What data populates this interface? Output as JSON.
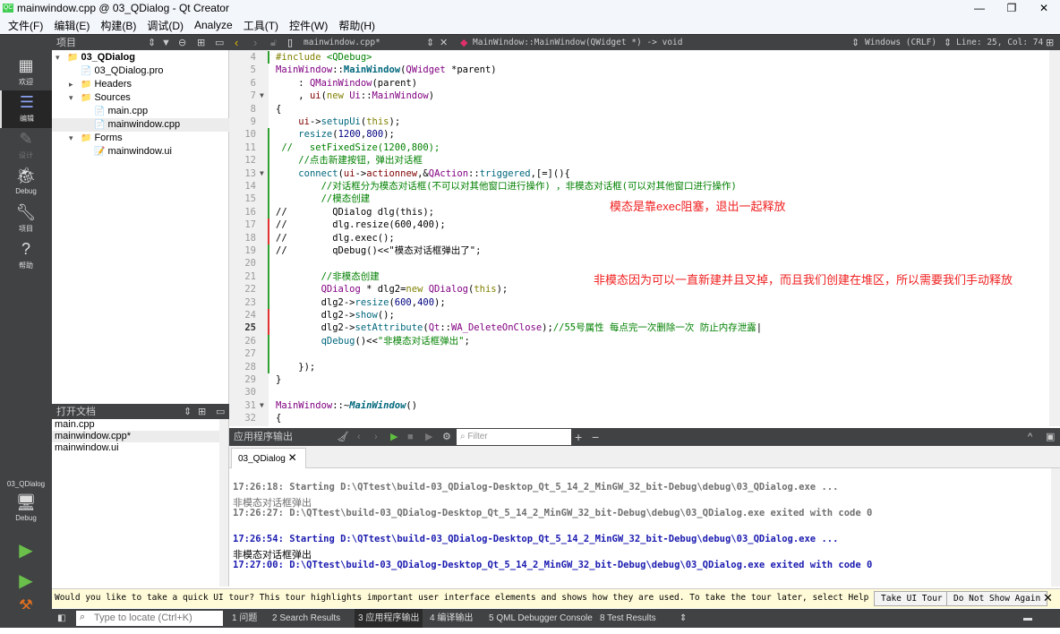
{
  "window": {
    "title": "mainwindow.cpp @ 03_QDialog - Qt Creator",
    "logo": "QC"
  },
  "menu": [
    "文件(F)",
    "编辑(E)",
    "构建(B)",
    "调试(D)",
    "Analyze",
    "工具(T)",
    "控件(W)",
    "帮助(H)"
  ],
  "toolbar": {
    "panel_title": "项目",
    "file": "mainwindow.cpp*",
    "symbol": "MainWindow::MainWindow(QWidget *) -> void",
    "encoding": "Windows (CRLF)",
    "position": "Line: 25, Col: 74"
  },
  "modes": [
    {
      "label": "欢迎",
      "icon": "grid-icon"
    },
    {
      "label": "编辑",
      "icon": "edit-icon"
    },
    {
      "label": "设计",
      "icon": "pencil-icon"
    },
    {
      "label": "Debug",
      "icon": "bug-icon"
    },
    {
      "label": "项目",
      "icon": "wrench-icon"
    },
    {
      "label": "帮助",
      "icon": "help-icon"
    }
  ],
  "kit": {
    "project": "03_QDialog",
    "config": "Debug"
  },
  "tree": [
    {
      "label": "03_QDialog",
      "level": 0,
      "arrow": "▾",
      "icon": "📁",
      "bold": true
    },
    {
      "label": "03_QDialog.pro",
      "level": 1,
      "arrow": "",
      "icon": "📄"
    },
    {
      "label": "Headers",
      "level": 1,
      "arrow": "▸",
      "icon": "📁"
    },
    {
      "label": "Sources",
      "level": 1,
      "arrow": "▾",
      "icon": "📁"
    },
    {
      "label": "main.cpp",
      "level": 2,
      "arrow": "",
      "icon": "📄"
    },
    {
      "label": "mainwindow.cpp",
      "level": 2,
      "arrow": "",
      "icon": "📄",
      "selected": true
    },
    {
      "label": "Forms",
      "level": 1,
      "arrow": "▾",
      "icon": "📁"
    },
    {
      "label": "mainwindow.ui",
      "level": 2,
      "arrow": "",
      "icon": "📝"
    }
  ],
  "open_docs": {
    "title": "打开文档",
    "items": [
      "main.cpp",
      "mainwindow.cpp*",
      "mainwindow.ui"
    ],
    "selected": 1
  },
  "code": [
    {
      "n": 4,
      "mk": "g",
      "s": [
        [
          "#include ",
          "k"
        ],
        [
          "<QDebug>",
          "s"
        ]
      ]
    },
    {
      "n": 5,
      "s": [
        [
          "MainWindow",
          "t"
        ],
        [
          "::",
          ""
        ],
        [
          "MainWindow",
          "fb"
        ],
        [
          "(",
          ""
        ],
        [
          "QWidget",
          "t"
        ],
        [
          " *parent)",
          ""
        ]
      ]
    },
    {
      "n": 6,
      "s": [
        [
          "    : ",
          ""
        ],
        [
          "QMainWindow",
          "t"
        ],
        [
          "(parent)",
          ""
        ]
      ]
    },
    {
      "n": 7,
      "fold": true,
      "s": [
        [
          "    , ",
          ""
        ],
        [
          "ui",
          "m"
        ],
        [
          "(",
          ""
        ],
        [
          "new ",
          "k"
        ],
        [
          "Ui",
          "t"
        ],
        [
          "::",
          ""
        ],
        [
          "MainWindow",
          "t"
        ],
        [
          ")",
          ""
        ]
      ]
    },
    {
      "n": 8,
      "s": [
        [
          "{",
          ""
        ]
      ]
    },
    {
      "n": 9,
      "s": [
        [
          "    ",
          ""
        ],
        [
          "ui",
          "m"
        ],
        [
          "->",
          ""
        ],
        [
          "setupUi",
          "f"
        ],
        [
          "(",
          ""
        ],
        [
          "this",
          "k"
        ],
        [
          ");",
          ""
        ]
      ]
    },
    {
      "n": 10,
      "mk": "g",
      "s": [
        [
          "    ",
          ""
        ],
        [
          "resize",
          "f"
        ],
        [
          "(",
          ""
        ],
        [
          "1200",
          "n"
        ],
        [
          ",",
          ""
        ],
        [
          "800",
          "n"
        ],
        [
          ");",
          ""
        ]
      ]
    },
    {
      "n": 11,
      "mk": "g",
      "s": [
        [
          " //   setFixedSize(1200,800);",
          "c"
        ]
      ]
    },
    {
      "n": 12,
      "mk": "g",
      "s": [
        [
          "    //点击新建按钮，弹出对话框",
          "c"
        ]
      ]
    },
    {
      "n": 13,
      "mk": "g",
      "fold": true,
      "s": [
        [
          "    ",
          ""
        ],
        [
          "connect",
          "f"
        ],
        [
          "(",
          ""
        ],
        [
          "ui",
          "m"
        ],
        [
          "->",
          ""
        ],
        [
          "actionnew",
          "m"
        ],
        [
          ",&",
          ""
        ],
        [
          "QAction",
          "t"
        ],
        [
          "::",
          ""
        ],
        [
          "triggered",
          "f"
        ],
        [
          ",[=](){",
          ""
        ]
      ]
    },
    {
      "n": 14,
      "mk": "g",
      "s": [
        [
          "        //对话框分为模态对话框(不可以对其他窗口进行操作) ，非模态对话框(可以对其他窗口进行操作)",
          "c"
        ]
      ]
    },
    {
      "n": 15,
      "mk": "g",
      "s": [
        [
          "        //模态创建",
          "c"
        ]
      ]
    },
    {
      "n": 16,
      "mk": "g",
      "s": [
        [
          "//        QDialog dlg(this);",
          ""
        ]
      ]
    },
    {
      "n": 17,
      "mk": "r",
      "s": [
        [
          "//        dlg.resize(600,400);",
          ""
        ]
      ]
    },
    {
      "n": 18,
      "mk": "r",
      "s": [
        [
          "//        dlg.exec();",
          ""
        ]
      ]
    },
    {
      "n": 19,
      "mk": "g",
      "s": [
        [
          "//        qDebug()<<\"模态对话框弹出了\";",
          ""
        ]
      ]
    },
    {
      "n": 20,
      "mk": "g",
      "s": [
        [
          "",
          ""
        ]
      ]
    },
    {
      "n": 21,
      "mk": "g",
      "s": [
        [
          "        //非模态创建",
          "c"
        ]
      ]
    },
    {
      "n": 22,
      "mk": "g",
      "s": [
        [
          "        ",
          ""
        ],
        [
          "QDialog",
          "t"
        ],
        [
          " * dlg2=",
          ""
        ],
        [
          "new ",
          "k"
        ],
        [
          "QDialog",
          "t"
        ],
        [
          "(",
          ""
        ],
        [
          "this",
          "k"
        ],
        [
          ");",
          ""
        ]
      ]
    },
    {
      "n": 23,
      "mk": "g",
      "s": [
        [
          "        dlg2->",
          ""
        ],
        [
          "resize",
          "f"
        ],
        [
          "(",
          ""
        ],
        [
          "600",
          "n"
        ],
        [
          ",",
          ""
        ],
        [
          "400",
          "n"
        ],
        [
          ");",
          ""
        ]
      ]
    },
    {
      "n": 24,
      "mk": "r",
      "s": [
        [
          "        dlg2->",
          ""
        ],
        [
          "show",
          "f"
        ],
        [
          "();",
          ""
        ]
      ]
    },
    {
      "n": 25,
      "mk": "r",
      "cur": true,
      "s": [
        [
          "        dlg2->",
          ""
        ],
        [
          "setAttribute",
          "f"
        ],
        [
          "(",
          ""
        ],
        [
          "Qt",
          "t"
        ],
        [
          "::",
          ""
        ],
        [
          "WA_DeleteOnClose",
          "t"
        ],
        [
          ");",
          ""
        ],
        [
          "//55号属性 每点完一次删除一次 防止内存泄露",
          "c"
        ],
        [
          "|",
          ""
        ]
      ]
    },
    {
      "n": 26,
      "mk": "g",
      "s": [
        [
          "        ",
          ""
        ],
        [
          "qDebug",
          "f"
        ],
        [
          "()<<",
          ""
        ],
        [
          "\"非模态对话框弹出\"",
          "s"
        ],
        [
          ";",
          ""
        ]
      ]
    },
    {
      "n": 27,
      "mk": "g",
      "s": [
        [
          "",
          ""
        ]
      ]
    },
    {
      "n": 28,
      "mk": "g",
      "s": [
        [
          "    });",
          ""
        ]
      ]
    },
    {
      "n": 29,
      "s": [
        [
          "}",
          ""
        ]
      ]
    },
    {
      "n": 30,
      "s": [
        [
          "",
          ""
        ]
      ]
    },
    {
      "n": 31,
      "fold": true,
      "s": [
        [
          "MainWindow",
          "t"
        ],
        [
          "::~",
          ""
        ],
        [
          "MainWindow",
          "fi"
        ],
        [
          "()",
          ""
        ]
      ]
    },
    {
      "n": 32,
      "s": [
        [
          "{",
          ""
        ]
      ]
    }
  ],
  "annotations": [
    "模态是靠exec阻塞，退出一起释放",
    "非模态因为可以一直新建并且叉掉，而且我们创建在堆区，所以需要我们手动释放"
  ],
  "output": {
    "title": "应用程序输出",
    "filter_placeholder": "Filter",
    "tab": "03_QDialog",
    "lines": [
      {
        "text": "17:26:18: Starting D:\\QTtest\\build-03_QDialog-Desktop_Qt_5_14_2_MinGW_32_bit-Debug\\debug\\03_QDialog.exe ...",
        "style": "old"
      },
      {
        "text": "非模态对话框弹出",
        "style": "old plain"
      },
      {
        "text": "17:26:27: D:\\QTtest\\build-03_QDialog-Desktop_Qt_5_14_2_MinGW_32_bit-Debug\\debug\\03_QDialog.exe exited with code 0",
        "style": "old"
      },
      {
        "text": "17:26:54: Starting D:\\QTtest\\build-03_QDialog-Desktop_Qt_5_14_2_MinGW_32_bit-Debug\\debug\\03_QDialog.exe ...",
        "style": "newc"
      },
      {
        "text": "非模态对话框弹出",
        "style": "plain"
      },
      {
        "text": "17:27:00: D:\\QTtest\\build-03_QDialog-Desktop_Qt_5_14_2_MinGW_32_bit-Debug\\debug\\03_QDialog.exe exited with code 0",
        "style": "newc"
      }
    ]
  },
  "tour": {
    "text": "Would you like to take a quick UI tour? This tour highlights important user interface elements and shows how they are used. To take the tour later, select Help > UI Tour.",
    "take": "Take UI Tour",
    "dismiss": "Do Not Show Again"
  },
  "status": {
    "locate_placeholder": "Type to locate (Ctrl+K)",
    "tabs": [
      "1 问题",
      "2 Search Results",
      "3 应用程序输出",
      "4 编译输出",
      "5 QML Debugger Console",
      "8 Test Results"
    ],
    "active": 2
  }
}
